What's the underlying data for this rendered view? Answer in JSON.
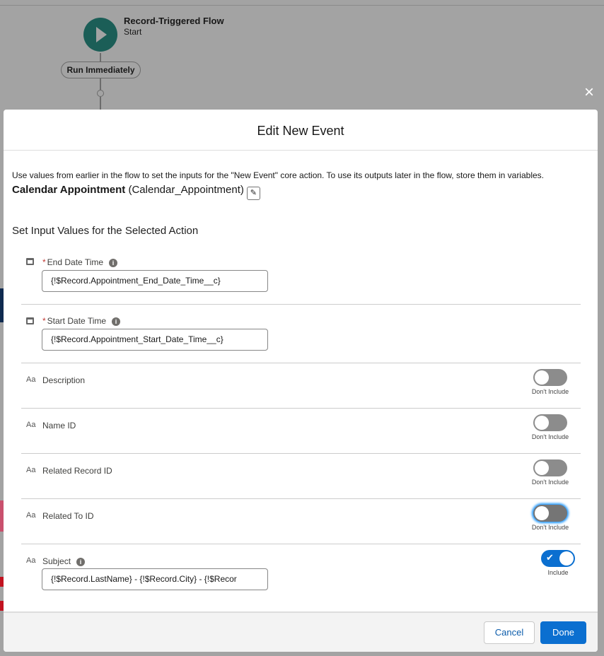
{
  "canvas": {
    "flow_title": "Record-Triggered Flow",
    "flow_subtitle": "Start",
    "run_label": "Run Immediately"
  },
  "modal": {
    "title": "Edit New Event",
    "intro": "Use values from earlier in the flow to set the inputs for the \"New Event\" core action. To use its outputs later in the flow, store them in variables.",
    "action_label": "Calendar Appointment",
    "action_api_name": "(Calendar_Appointment)",
    "section_title": "Set Input Values for the Selected Action",
    "fields": [
      {
        "label": "End Date Time",
        "required": true,
        "icon": "calendar-icon",
        "value": "{!$Record.Appointment_End_Date_Time__c}"
      },
      {
        "label": "Start Date Time",
        "required": true,
        "icon": "calendar-icon",
        "value": "{!$Record.Appointment_Start_Date_Time__c}"
      },
      {
        "label": "Description",
        "icon": "text-icon",
        "include": false,
        "toggle_label": "Don't Include"
      },
      {
        "label": "Name ID",
        "icon": "text-icon",
        "include": false,
        "toggle_label": "Don't Include"
      },
      {
        "label": "Related Record ID",
        "icon": "text-icon",
        "include": false,
        "toggle_label": "Don't Include"
      },
      {
        "label": "Related To ID",
        "icon": "text-icon",
        "include": false,
        "toggle_label": "Don't Include"
      },
      {
        "label": "Subject",
        "icon": "text-icon",
        "include": true,
        "toggle_label": "Include",
        "value": "{!$Record.LastName} - {!$Record.City} - {!$Recor"
      }
    ],
    "cancel": "Cancel",
    "done": "Done",
    "close_icon": "×",
    "required_marker": "*",
    "info_glyph": "i",
    "text_icon_glyph": "Aa"
  },
  "colors": {
    "brand": "#0b6fd0",
    "start_node": "#1b5e57"
  }
}
